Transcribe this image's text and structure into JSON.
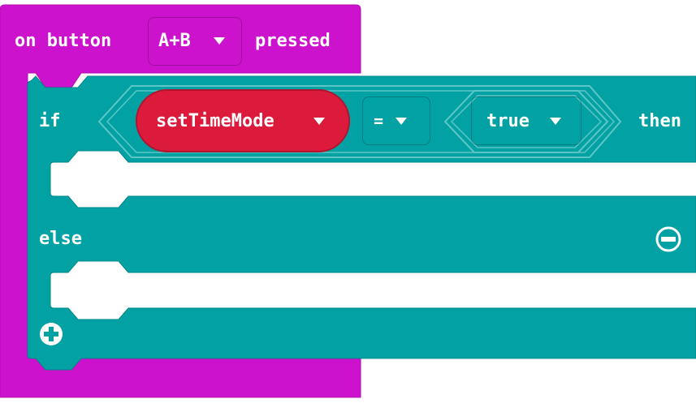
{
  "event_block": {
    "prefix": "on button",
    "button_value": "A+B",
    "suffix": "pressed",
    "color": "#cc12cc"
  },
  "if_block": {
    "if_label": "if",
    "then_label": "then",
    "else_label": "else",
    "color": "#02a1a3",
    "variable": {
      "name": "setTimeMode",
      "color": "#dc1a3c"
    },
    "operator": "=",
    "value": "true"
  },
  "icons": {
    "remove_else": "minus-circle-icon",
    "add_clause": "plus-circle-icon",
    "dropdown": "caret-down-icon"
  }
}
